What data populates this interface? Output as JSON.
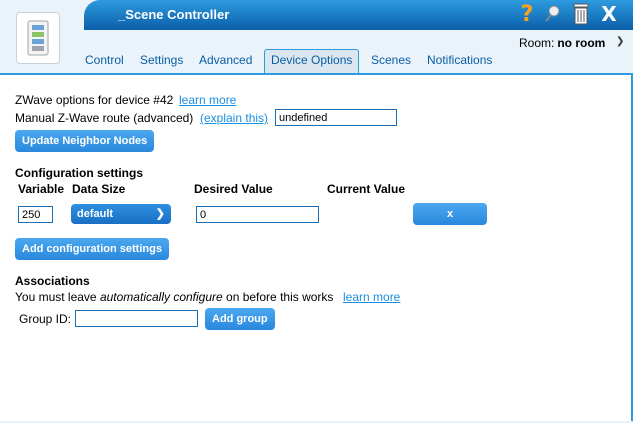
{
  "window": {
    "title": "_Scene Controller",
    "help_icon": "?",
    "close_icon": "X"
  },
  "room": {
    "label": "Room:",
    "value": "no room"
  },
  "tabs": [
    {
      "label": "Control"
    },
    {
      "label": "Settings"
    },
    {
      "label": "Advanced"
    },
    {
      "label": "Device Options",
      "active": true
    },
    {
      "label": "Scenes"
    },
    {
      "label": "Notifications"
    }
  ],
  "zwave": {
    "options_text": "ZWave options for device #42",
    "learn_more": "learn more",
    "route_label": "Manual Z-Wave route (advanced)",
    "explain_link": "(explain this)",
    "route_value": "undefined",
    "update_button": "Update Neighbor Nodes"
  },
  "config": {
    "heading": "Configuration settings",
    "columns": [
      "Variable",
      "Data Size",
      "Desired Value",
      "Current Value"
    ],
    "row": {
      "variable": "250",
      "data_size": "default",
      "desired_value": "0",
      "remove_button": "x"
    },
    "add_button": "Add configuration settings"
  },
  "associations": {
    "heading": "Associations",
    "note_prefix": "You must leave ",
    "note_emph": "automatically configure",
    "note_suffix": " on before this works",
    "learn_more": "learn more",
    "group_label": "Group ID:",
    "group_value": "",
    "add_group_button": "Add group"
  },
  "colors": {
    "accent": "#2e9be0",
    "title_bar_dark": "#0a5ea8",
    "button": "#2a88dd",
    "link": "#1a8fe0",
    "help_icon": "#f7a21b"
  }
}
